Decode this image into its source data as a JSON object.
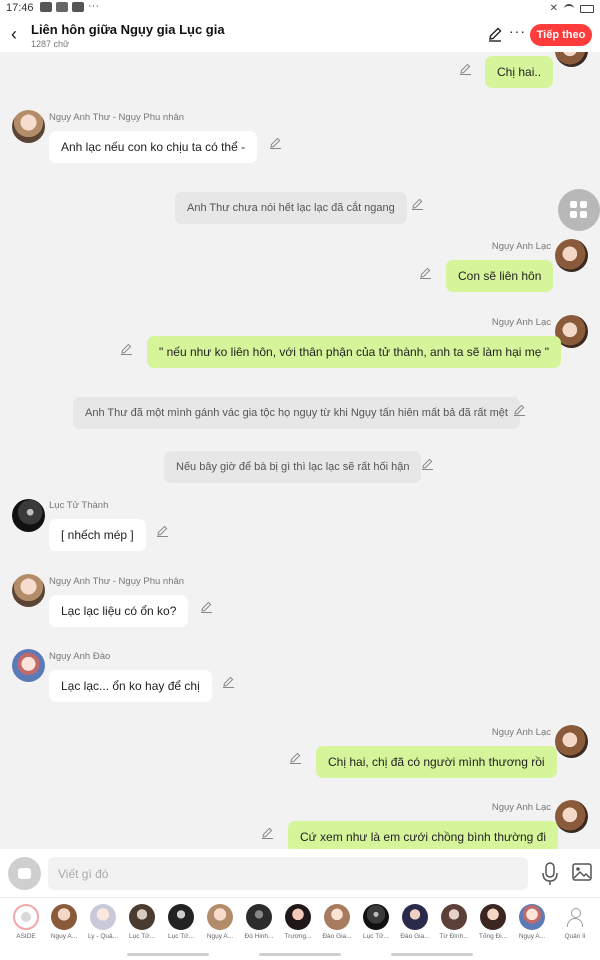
{
  "status_bar": {
    "time": "17:46",
    "dots": "···"
  },
  "header": {
    "title": "Liên hôn giữa Ngụy gia Lục gia",
    "subtitle": "1287 chữ",
    "more": "···",
    "next_button": "Tiếp theo",
    "accent_color": "#ff3b3b"
  },
  "messages": [
    {
      "type": "right",
      "name": "",
      "text": "Chị hai.."
    },
    {
      "type": "left",
      "name": "Ngụy Anh Thư - Ngụy Phu nhân",
      "text": "Anh lạc nếu con ko chịu ta có thể -"
    },
    {
      "type": "narration",
      "name": "",
      "text": "Anh Thư chưa nói hết lạc lạc đã cắt ngang"
    },
    {
      "type": "right",
      "name": "Ngụy Anh Lạc",
      "text": "Con sẽ liên hôn"
    },
    {
      "type": "right",
      "name": "Ngụy Anh Lạc",
      "text": "\" nếu như ko liên hôn, với thân phận của tử thành, anh ta sẽ làm hại mẹ \""
    },
    {
      "type": "narration",
      "name": "",
      "text": "Anh Thư đã một mình gánh vác gia tộc họ ngụy từ khi Ngụy tấn hiên mất bả đã rất mệt"
    },
    {
      "type": "narration",
      "name": "",
      "text": "Nếu bây giờ để bà bị gì thì lạc lạc sẽ rất hối hận"
    },
    {
      "type": "left",
      "name": "Lục Tử Thành",
      "text": "[ nhếch mép ]"
    },
    {
      "type": "left",
      "name": "Ngụy Anh Thư - Ngụy Phu nhân",
      "text": "Lạc lạc liệu có ổn ko?"
    },
    {
      "type": "left",
      "name": "Ngụy Anh Đào",
      "text": "Lạc lạc... ổn ko hay để chị"
    },
    {
      "type": "right",
      "name": "Ngụy Anh Lạc",
      "text": "Chị hai, chị đã có người mình thương rồi"
    },
    {
      "type": "right",
      "name": "Ngụy Anh Lạc",
      "text": "Cứ xem như là em cưới chồng bình thường đi"
    }
  ],
  "colors": {
    "right_bubble": "#d6f59a",
    "left_bubble": "#ffffff",
    "narration_bubble": "#e7e7e7",
    "background": "#f2f2f2"
  },
  "input": {
    "placeholder": "Viết gì đó"
  },
  "characters": [
    {
      "label": "ASIDE"
    },
    {
      "label": "Nguy A..."
    },
    {
      "label": "Ly - Quả..."
    },
    {
      "label": "Lục Tử..."
    },
    {
      "label": "Lục Tử..."
    },
    {
      "label": "Ngụy A..."
    },
    {
      "label": "Đỗ Hinh..."
    },
    {
      "label": "Trương..."
    },
    {
      "label": "Đào Gia..."
    },
    {
      "label": "Lục Tử..."
    },
    {
      "label": "Đào Gia..."
    },
    {
      "label": "Từ Đình..."
    },
    {
      "label": "Tống Đi..."
    },
    {
      "label": "Ngụy A..."
    },
    {
      "label": "Quản lí"
    }
  ]
}
